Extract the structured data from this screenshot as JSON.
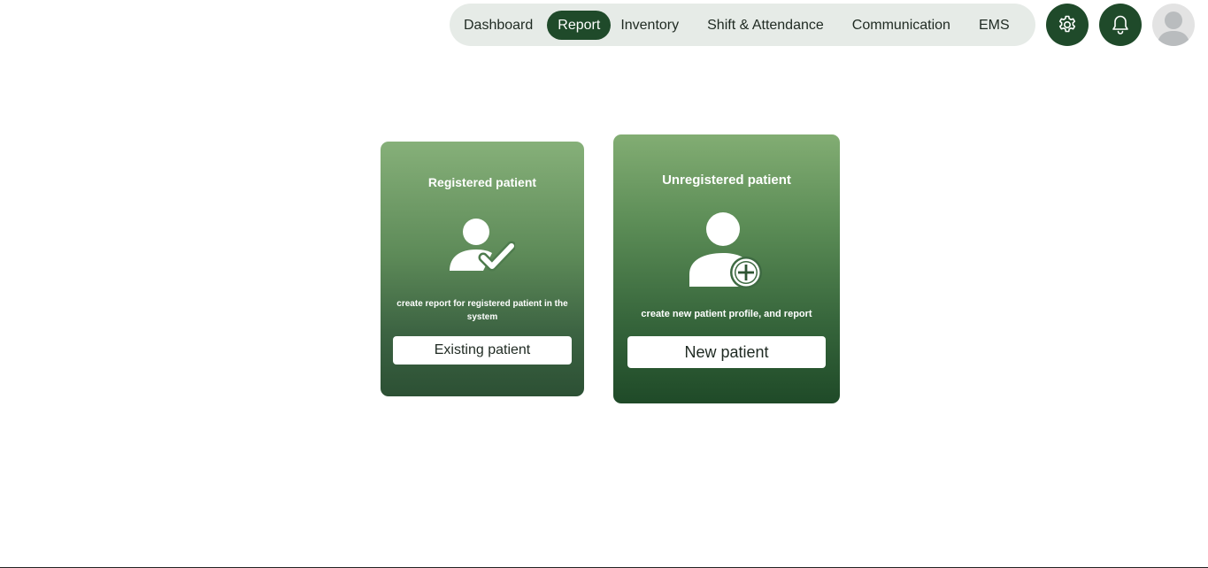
{
  "nav": {
    "items": [
      {
        "label": "Dashboard",
        "active": false
      },
      {
        "label": "Report",
        "active": true
      },
      {
        "label": "Inventory",
        "active": false
      },
      {
        "label": "Shift & Attendance",
        "active": false
      },
      {
        "label": "Communication",
        "active": false
      },
      {
        "label": "EMS",
        "active": false
      }
    ],
    "settings_icon": "gear-icon",
    "notifications_icon": "bell-icon",
    "avatar_icon": "user-avatar-icon"
  },
  "cards": {
    "registered": {
      "title": "Registered patient",
      "icon": "user-check-icon",
      "description": "create report for registered patient in the system",
      "button_label": "Existing patient"
    },
    "unregistered": {
      "title": "Unregistered patient",
      "icon": "user-plus-icon",
      "description": "create new patient profile, and report",
      "button_label": "New patient"
    }
  },
  "colors": {
    "accent": "#1f4a2a",
    "nav_background": "#e6ebe7",
    "card_gradient_top": "#86b079",
    "card_gradient_bottom": "#1f4a28"
  }
}
